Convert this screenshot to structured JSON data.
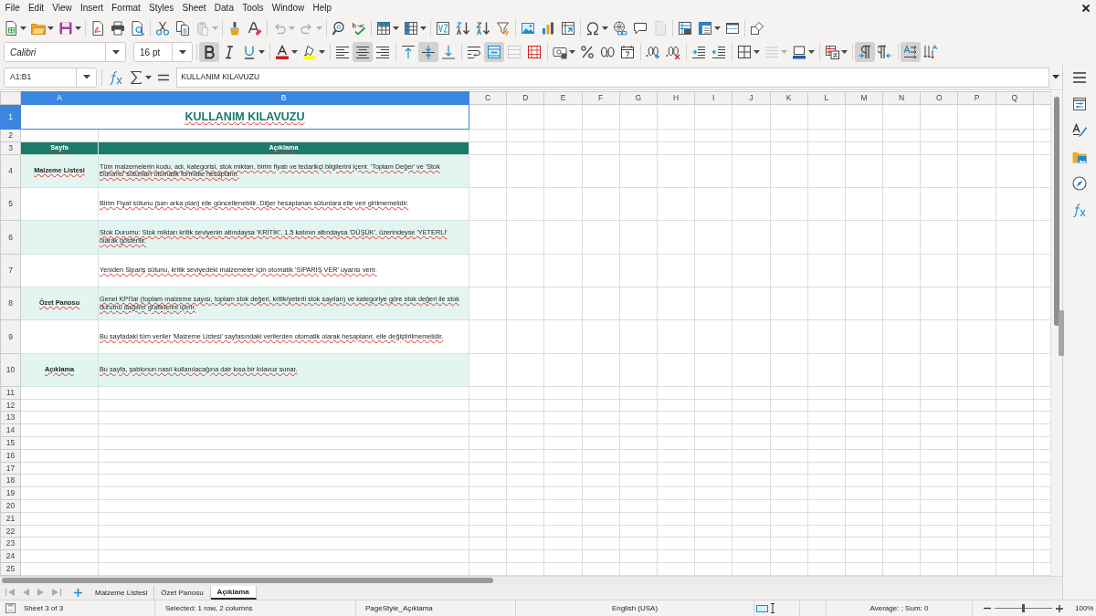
{
  "menu_bar": [
    "File",
    "Edit",
    "View",
    "Insert",
    "Format",
    "Styles",
    "Sheet",
    "Data",
    "Tools",
    "Window",
    "Help"
  ],
  "standard_toolbar": {
    "paste_disabled": true,
    "undo_disabled": true,
    "redo_disabled": true,
    "header_footer_disabled": true
  },
  "formatting_toolbar": {
    "font_name": "Calibri",
    "font_size": "16 pt",
    "bold": true,
    "italic": false,
    "underline": false,
    "align_left": false,
    "align_center": true,
    "align_right": false,
    "align_top": false,
    "align_middle": true,
    "align_bottom": false,
    "wrap_text": false,
    "merge_and_center": true,
    "merge_disabled": true,
    "border_style_disabled": true,
    "left_to_right": true,
    "right_to_left": false,
    "text_horizontal": true,
    "text_vertical": false
  },
  "formula_bar": {
    "name_box": "A1:B1",
    "content": "KULLANIM KILAVUZU"
  },
  "sheet": {
    "columns": [
      {
        "label": "A",
        "selected": true
      },
      {
        "label": "B",
        "selected": true
      },
      {
        "label": "C",
        "selected": false
      },
      {
        "label": "D",
        "selected": false
      },
      {
        "label": "E",
        "selected": false
      },
      {
        "label": "F",
        "selected": false
      },
      {
        "label": "G",
        "selected": false
      },
      {
        "label": "H",
        "selected": false
      },
      {
        "label": "I",
        "selected": false
      },
      {
        "label": "J",
        "selected": false
      },
      {
        "label": "K",
        "selected": false
      },
      {
        "label": "L",
        "selected": false
      },
      {
        "label": "M",
        "selected": false
      },
      {
        "label": "N",
        "selected": false
      },
      {
        "label": "O",
        "selected": false
      },
      {
        "label": "P",
        "selected": false
      },
      {
        "label": "Q",
        "selected": false
      }
    ],
    "rows": [
      {
        "number": "1",
        "selected": true,
        "kind": "title",
        "title": "KULLANIM KILAVUZU"
      },
      {
        "number": "2",
        "selected": false,
        "kind": "blank"
      },
      {
        "number": "3",
        "selected": false,
        "kind": "header",
        "page": "Sayfa",
        "description": "Açıklama"
      },
      {
        "number": "4",
        "selected": false,
        "kind": "entry",
        "shaded": true,
        "page": "Malzeme Listesi",
        "description": "Tüm malzemelerin kodu, adı, kategorisi, stok miktarı, birim fiyatı ve tedarikçi bilgilerini içerir. 'Toplam Değer' ve 'Stok Durumu' sütunları otomatik formülle hesaplanır."
      },
      {
        "number": "5",
        "selected": false,
        "kind": "entry",
        "shaded": false,
        "description": "Birim Fiyat sütunu (sarı arka plan) elle güncellenebilir. Diğer hesaplanan sütunlara elle veri girilmemelidir."
      },
      {
        "number": "6",
        "selected": false,
        "kind": "entry",
        "shaded": true,
        "description": "Stok Durumu: Stok miktarı kritik seviyenin altındaysa 'KRİTİK', 1.5 katının altındaysa 'DÜŞÜK', üzerindeyse 'YETERLİ' olarak gösterilir."
      },
      {
        "number": "7",
        "selected": false,
        "kind": "entry",
        "shaded": false,
        "description": "Yeniden Sipariş sütunu, kritik seviyedeki malzemeler için otomatik 'SİPARİŞ VER' uyarısı verir."
      },
      {
        "number": "8",
        "selected": false,
        "kind": "entry",
        "shaded": true,
        "page": "Özet Panosu",
        "description": "Genel KPI'lar (toplam malzeme sayısı, toplam stok değeri, kritik/yeterli stok sayıları) ve kategoriye göre stok değeri ile stok durumu dağılım grafiklerini içerir."
      },
      {
        "number": "9",
        "selected": false,
        "kind": "entry",
        "shaded": false,
        "description": "Bu sayfadaki tüm veriler 'Malzeme Listesi' sayfasındaki verilerden otomatik olarak hesaplanır, elle değiştirilmemelidir."
      },
      {
        "number": "10",
        "selected": false,
        "kind": "entry",
        "shaded": true,
        "page": "Açıklama",
        "description": "Bu sayfa, şablonun nasıl kullanılacağına dair kısa bir kılavuz sunar."
      },
      {
        "number": "11",
        "selected": false,
        "kind": "blank"
      },
      {
        "number": "12",
        "selected": false,
        "kind": "blank"
      },
      {
        "number": "13",
        "selected": false,
        "kind": "blank"
      },
      {
        "number": "14",
        "selected": false,
        "kind": "blank"
      },
      {
        "number": "15",
        "selected": false,
        "kind": "blank"
      },
      {
        "number": "16",
        "selected": false,
        "kind": "blank"
      },
      {
        "number": "17",
        "selected": false,
        "kind": "blank"
      },
      {
        "number": "18",
        "selected": false,
        "kind": "blank"
      },
      {
        "number": "19",
        "selected": false,
        "kind": "blank"
      },
      {
        "number": "20",
        "selected": false,
        "kind": "blank"
      },
      {
        "number": "21",
        "selected": false,
        "kind": "blank"
      },
      {
        "number": "22",
        "selected": false,
        "kind": "blank"
      },
      {
        "number": "23",
        "selected": false,
        "kind": "blank"
      },
      {
        "number": "24",
        "selected": false,
        "kind": "blank"
      },
      {
        "number": "25",
        "selected": false,
        "kind": "blank"
      }
    ]
  },
  "sheet_tabs": {
    "navigation_disabled": true,
    "tabs": [
      {
        "label": "Malzeme Listesi",
        "selected": false
      },
      {
        "label": "Özet Panosu",
        "selected": false
      },
      {
        "label": "Açıklama",
        "selected": true
      }
    ]
  },
  "status_bar": {
    "sheet": "Sheet 3 of 3",
    "selection": "Selected: 1 row, 2 columns",
    "page_style": "PageStyle_Açıklama",
    "language": "English (USA)",
    "summary": "Average: ; Sum: 0",
    "zoom": {
      "level": 0.5,
      "label": "100%"
    }
  }
}
